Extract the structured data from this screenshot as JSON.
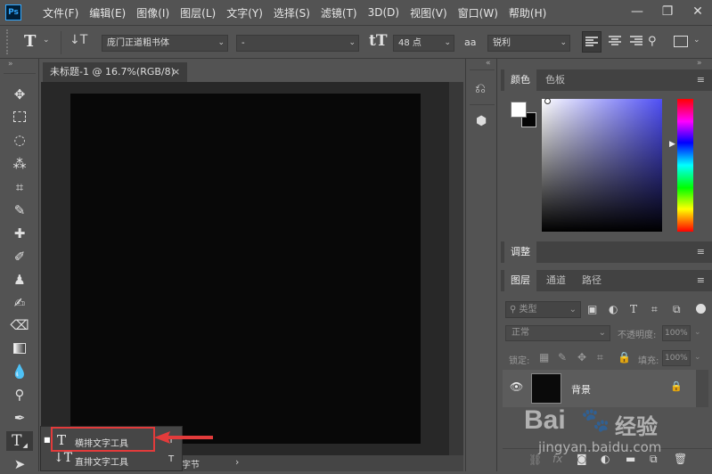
{
  "app": {
    "logo": "Ps"
  },
  "menubar": {
    "items": [
      "文件(F)",
      "编辑(E)",
      "图像(I)",
      "图层(L)",
      "文字(Y)",
      "选择(S)",
      "滤镜(T)",
      "3D(D)",
      "视图(V)",
      "窗口(W)",
      "帮助(H)"
    ],
    "minimize": "—",
    "restore": "❐",
    "close": "✕"
  },
  "options": {
    "tool_icon": "T",
    "font_family": "庞门正道粗书体",
    "font_style": "-",
    "font_size": "48 点",
    "aa_label": "aa",
    "antialias": "锐利"
  },
  "document": {
    "tab_title": "未标题-1 @ 16.7%(RGB/8)",
    "tab_close": "×",
    "status_text": "字节"
  },
  "flyout": {
    "items": [
      {
        "label": "横排文字工具",
        "shortcut": "T"
      },
      {
        "label": "直排文字工具",
        "shortcut": "T"
      }
    ]
  },
  "panels": {
    "color_tabs": [
      "颜色",
      "色板"
    ],
    "adjust_tab": "调整",
    "layer_tabs": [
      "图层",
      "通道",
      "路径"
    ],
    "filter_kind": "类型",
    "blend_mode": "正常",
    "opacity_label": "不透明度:",
    "opacity_value": "100%",
    "lock_label": "锁定:",
    "fill_label": "填充:",
    "fill_value": "100%",
    "layer_name": "背景",
    "bottom_fx": "fx"
  },
  "watermark": {
    "brand": "Bai",
    "brand2": "经验",
    "url": "jingyan.baidu.com"
  },
  "colors": {
    "accent": "#31a8ff",
    "highlight": "#e23b3b",
    "canvas": "#080808"
  }
}
